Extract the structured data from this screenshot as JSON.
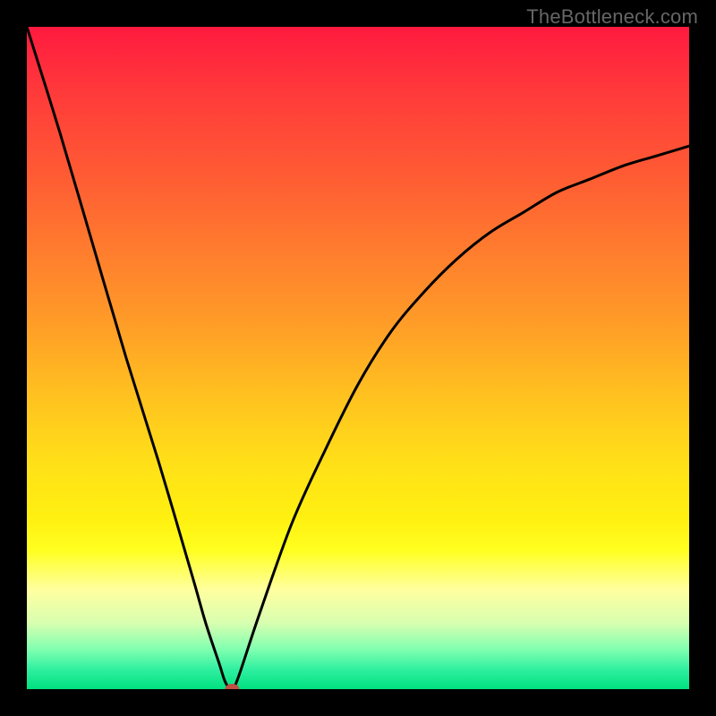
{
  "watermark": "TheBottleneck.com",
  "colors": {
    "frame": "#000000",
    "curve": "#000000",
    "marker": "#c05045",
    "gradient_top": "#ff1a3f",
    "gradient_bottom": "#00e080"
  },
  "chart_data": {
    "type": "line",
    "title": "",
    "xlabel": "",
    "ylabel": "",
    "xlim": [
      0,
      100
    ],
    "ylim": [
      0,
      100
    ],
    "x": [
      0,
      5,
      10,
      15,
      20,
      25,
      27,
      29,
      30,
      31,
      32,
      35,
      40,
      45,
      50,
      55,
      60,
      65,
      70,
      75,
      80,
      85,
      90,
      95,
      100
    ],
    "values": [
      100,
      84,
      67,
      50,
      34,
      17,
      10,
      4,
      1,
      0,
      2,
      11,
      25,
      36,
      46,
      54,
      60,
      65,
      69,
      72,
      75,
      77,
      79,
      80.5,
      82
    ],
    "minimum_point": {
      "x": 31,
      "y": 0
    },
    "annotations": [],
    "legend": []
  }
}
